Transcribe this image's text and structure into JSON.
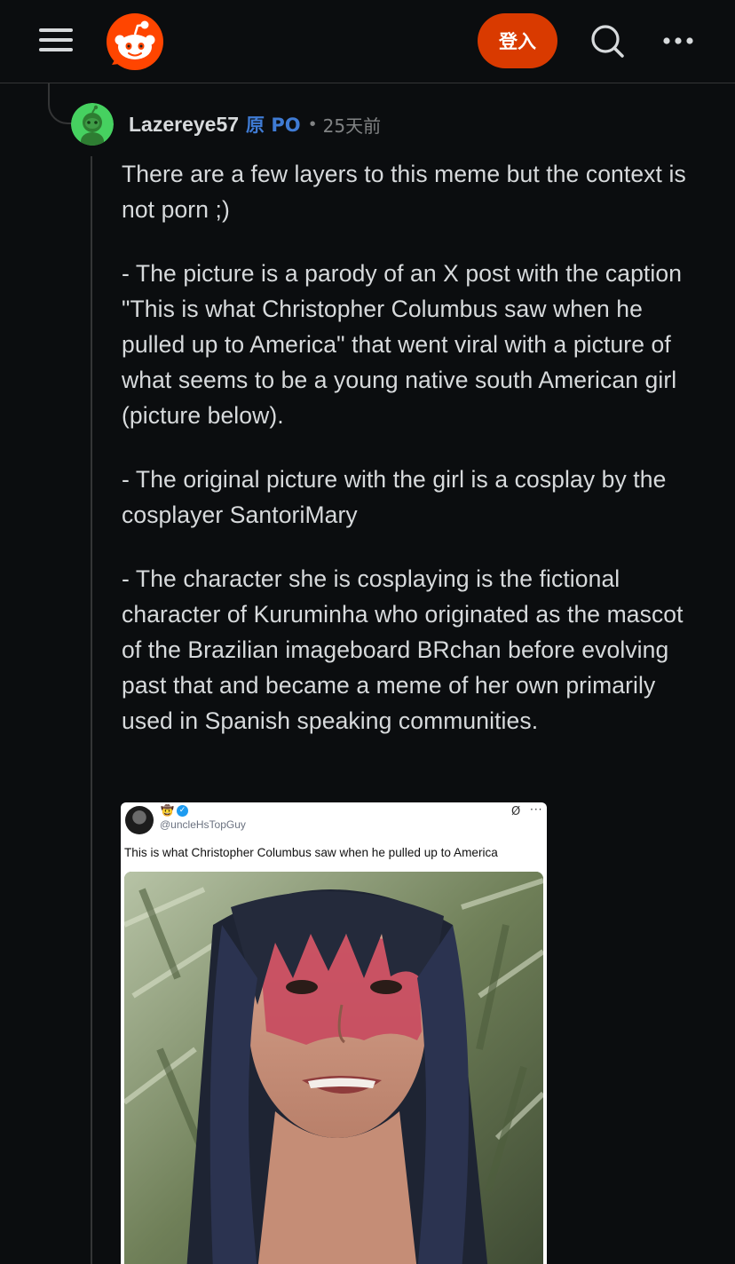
{
  "header": {
    "login_label": "登入",
    "menu_icon": "hamburger-menu-icon",
    "logo_icon": "reddit-logo-icon",
    "search_icon": "search-icon",
    "more_icon": "more-options-icon",
    "brand_color": "#d93a00"
  },
  "comment": {
    "username": "Lazereye57",
    "op_tag": "原 PO",
    "separator": "•",
    "age": "25天前",
    "paragraphs": [
      "There are a few layers to this meme but the context is not porn ;)",
      "- The picture is a parody of an X post with the caption \"This is what Christopher Columbus saw when he pulled up to America\" that went viral with a picture of what seems to be a young native south American girl (picture below).",
      "- The original picture with the girl is a cosplay by the cosplayer SantoriMary",
      "- The character she is cosplaying is the fictional character of Kuruminha who originated as the mascot of the Brazilian imageboard BRchan before evolving past that and became a meme of her own primarily used in Spanish speaking communities."
    ]
  },
  "embed": {
    "handle": "@uncleHsTopGuy",
    "caption": "This is what Christopher Columbus saw when he pulled up to America",
    "emoji": "🤠",
    "verified_mark": "✓",
    "grok_icon": "Ø",
    "more_dots": "···"
  }
}
